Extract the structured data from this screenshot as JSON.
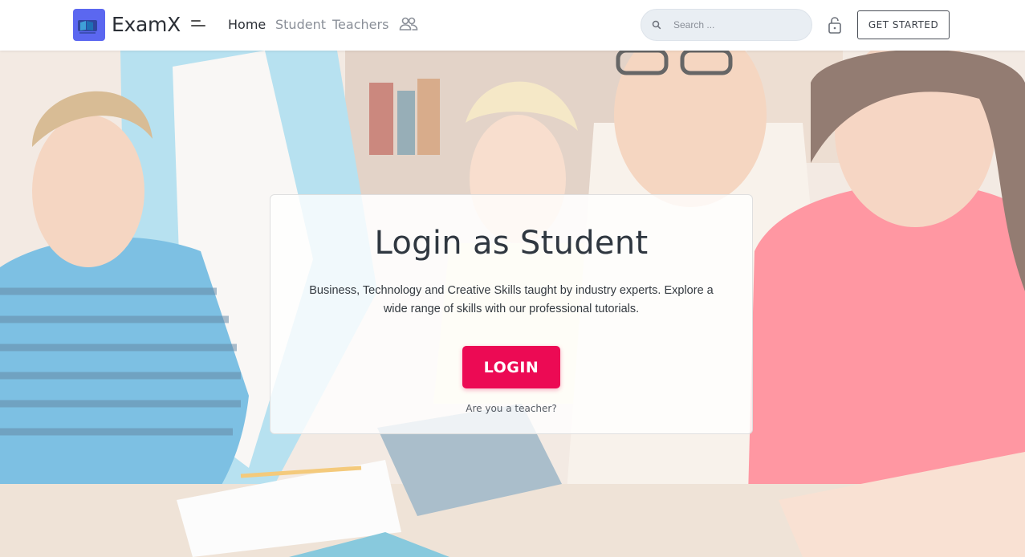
{
  "navbar": {
    "brand": "ExamX",
    "logo_icon": "examx-logo-icon",
    "links": [
      {
        "label": "Home",
        "active": true
      },
      {
        "label": "Student",
        "active": false
      },
      {
        "label": "Teachers",
        "active": false
      }
    ],
    "search": {
      "placeholder": "Search ..."
    },
    "cta_label": "GET STARTED",
    "icons": [
      "menu-icon",
      "people-icon",
      "search-icon",
      "lock-icon"
    ]
  },
  "hero": {
    "background": "students-group-photo",
    "card": {
      "title": "Login as Student",
      "description": "Business, Technology and Creative Skills taught by industry experts. Explore a wide range of skills with our professional tutorials.",
      "login_label": "LOGIN",
      "teacher_link": "Are you a teacher?"
    }
  },
  "colors": {
    "accent": "#ec0a54",
    "logo_bg": "#5b67f0",
    "text_dark": "#2f3740",
    "nav_muted": "#8a8f98"
  }
}
